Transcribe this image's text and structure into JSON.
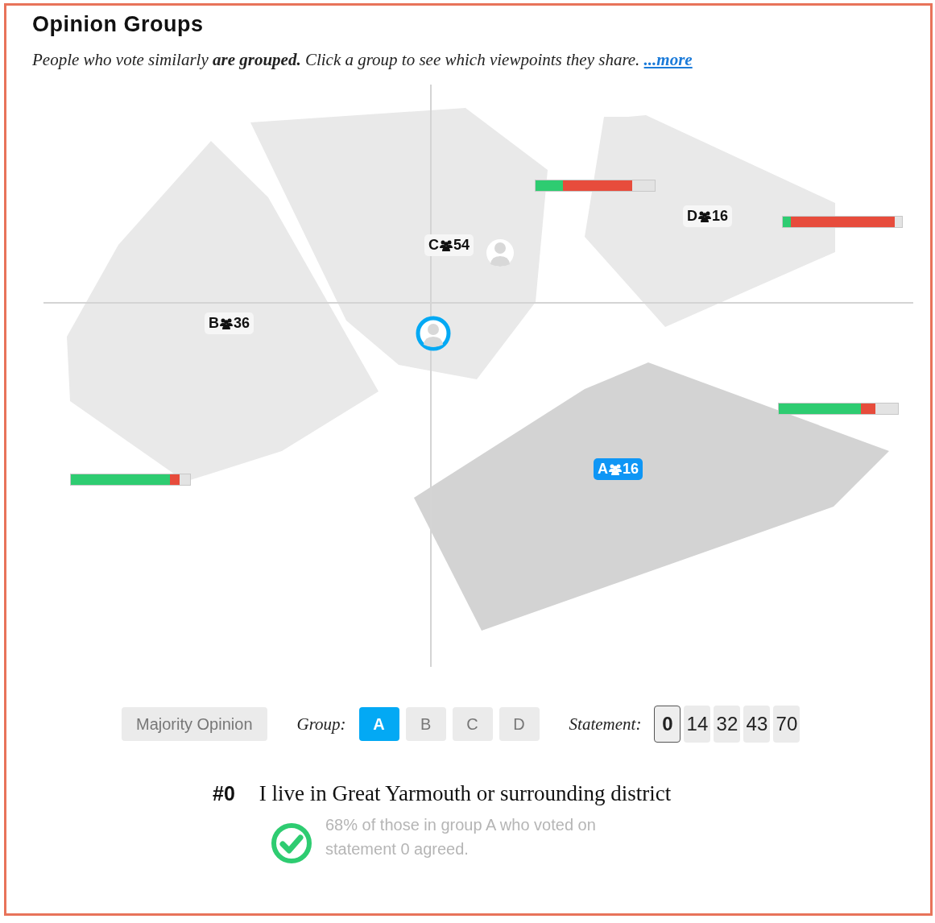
{
  "title": "Opinion Groups",
  "subtitle": {
    "text": "People who vote similarly **are grouped.** Click a group to see which viewpoints they share.",
    "link": "...more"
  },
  "map": {
    "groups": [
      {
        "label": "C",
        "count": "54",
        "selected": false,
        "bar": {
          "agree": {
            "level": 0.23
          },
          "voted": {
            "level": 0.81
          }
        }
      },
      {
        "label": "D",
        "count": "16",
        "selected": false,
        "bar": {
          "agree": {
            "level": 0.07
          },
          "voted": {
            "level": 0.94
          }
        }
      },
      {
        "label": "B",
        "count": "36",
        "selected": false,
        "bar": {
          "agree": {
            "level": 0.83
          },
          "voted": {
            "level": 0.91
          }
        }
      },
      {
        "label": "A",
        "count": "16",
        "selected": true,
        "bar": {
          "agree": {
            "level": 0.69
          },
          "voted": {
            "level": 0.81
          }
        }
      }
    ]
  },
  "controls": {
    "majority_button": "Majority Opinion",
    "group_label": "Group:",
    "groups": [
      {
        "label": "A",
        "selected": true
      },
      {
        "label": "B",
        "selected": false
      },
      {
        "label": "C",
        "selected": false
      },
      {
        "label": "D",
        "selected": false
      }
    ],
    "statement_label": "Statement:",
    "statements": [
      {
        "label": "0",
        "selected": true
      },
      {
        "label": "14",
        "selected": false
      },
      {
        "label": "32",
        "selected": false
      },
      {
        "label": "43",
        "selected": false
      },
      {
        "label": "70",
        "selected": false
      }
    ]
  },
  "statement": {
    "number": "#0",
    "text": "I live in Great Yarmouth or surrounding district",
    "result": "68% of those in group A who voted on statement 0 agreed."
  }
}
